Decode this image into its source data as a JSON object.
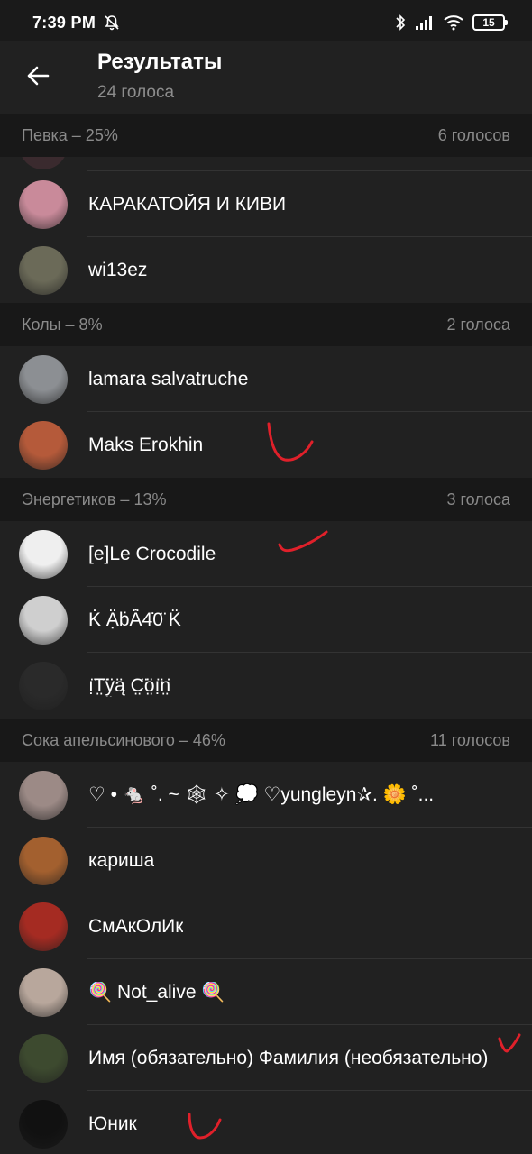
{
  "status_bar": {
    "time": "7:39 PM",
    "battery": "15",
    "icons": [
      "mute-icon",
      "bluetooth-icon",
      "signal-icon",
      "wifi-icon",
      "battery-icon"
    ]
  },
  "header": {
    "title": "Результаты",
    "subtitle": "24 голоса",
    "back_icon": "arrow-left-icon"
  },
  "sections": [
    {
      "label": "Певка – 25%",
      "count": "6 голосов",
      "voters": [
        {
          "name": "КАРАКАТОЙЯ И КИВИ",
          "avatar_color": "#c98a9a"
        },
        {
          "name": "wi13ez",
          "avatar_color": "#6b6a58"
        }
      ]
    },
    {
      "label": "Колы – 8%",
      "count": "2 голоса",
      "voters": [
        {
          "name": "lamara salvatruche",
          "avatar_color": "#8c8f93"
        },
        {
          "name": "Maks Erokhin",
          "avatar_color": "#b55a3a"
        }
      ]
    },
    {
      "label": "Энергетиков – 13%",
      "count": "3 голоса",
      "voters": [
        {
          "name": "[e]Le Crocodile",
          "avatar_color": "#efefef"
        },
        {
          "name": "K̇ Ạ̈ḃȦ̈4̇0̈ K̈",
          "avatar_color": "#cfcfcf"
        },
        {
          "name": "ı̣̈T̤̈ÿ̤ą̈ C̤̈ö̤ı̣̈n̤̈",
          "avatar_color": "#2a2a2a"
        }
      ]
    },
    {
      "label": "Сока апельсинового – 46%",
      "count": "11 голосов",
      "voters": [
        {
          "name": "♡ • 🐁 ˚. ~ 🕸 ✧ 💭 ♡yungleyn✰. 🌼 ˚...",
          "avatar_color": "#9c8a86"
        },
        {
          "name": "кариша",
          "avatar_color": "#a3602f"
        },
        {
          "name": "СмАкОлИк",
          "avatar_color": "#a52b22"
        },
        {
          "name": "🍭 Not_alive 🍭",
          "avatar_color": "#b8a79c"
        },
        {
          "name": "Имя (обязательно) Фамилия (необязательно)",
          "avatar_color": "#3d4a2f"
        },
        {
          "name": "Юник",
          "avatar_color": "#111111"
        }
      ]
    }
  ],
  "colors": {
    "background": "#212121",
    "section_background": "#181818",
    "secondary_text": "#8a8a8a",
    "annotation_red": "#e0202a"
  }
}
